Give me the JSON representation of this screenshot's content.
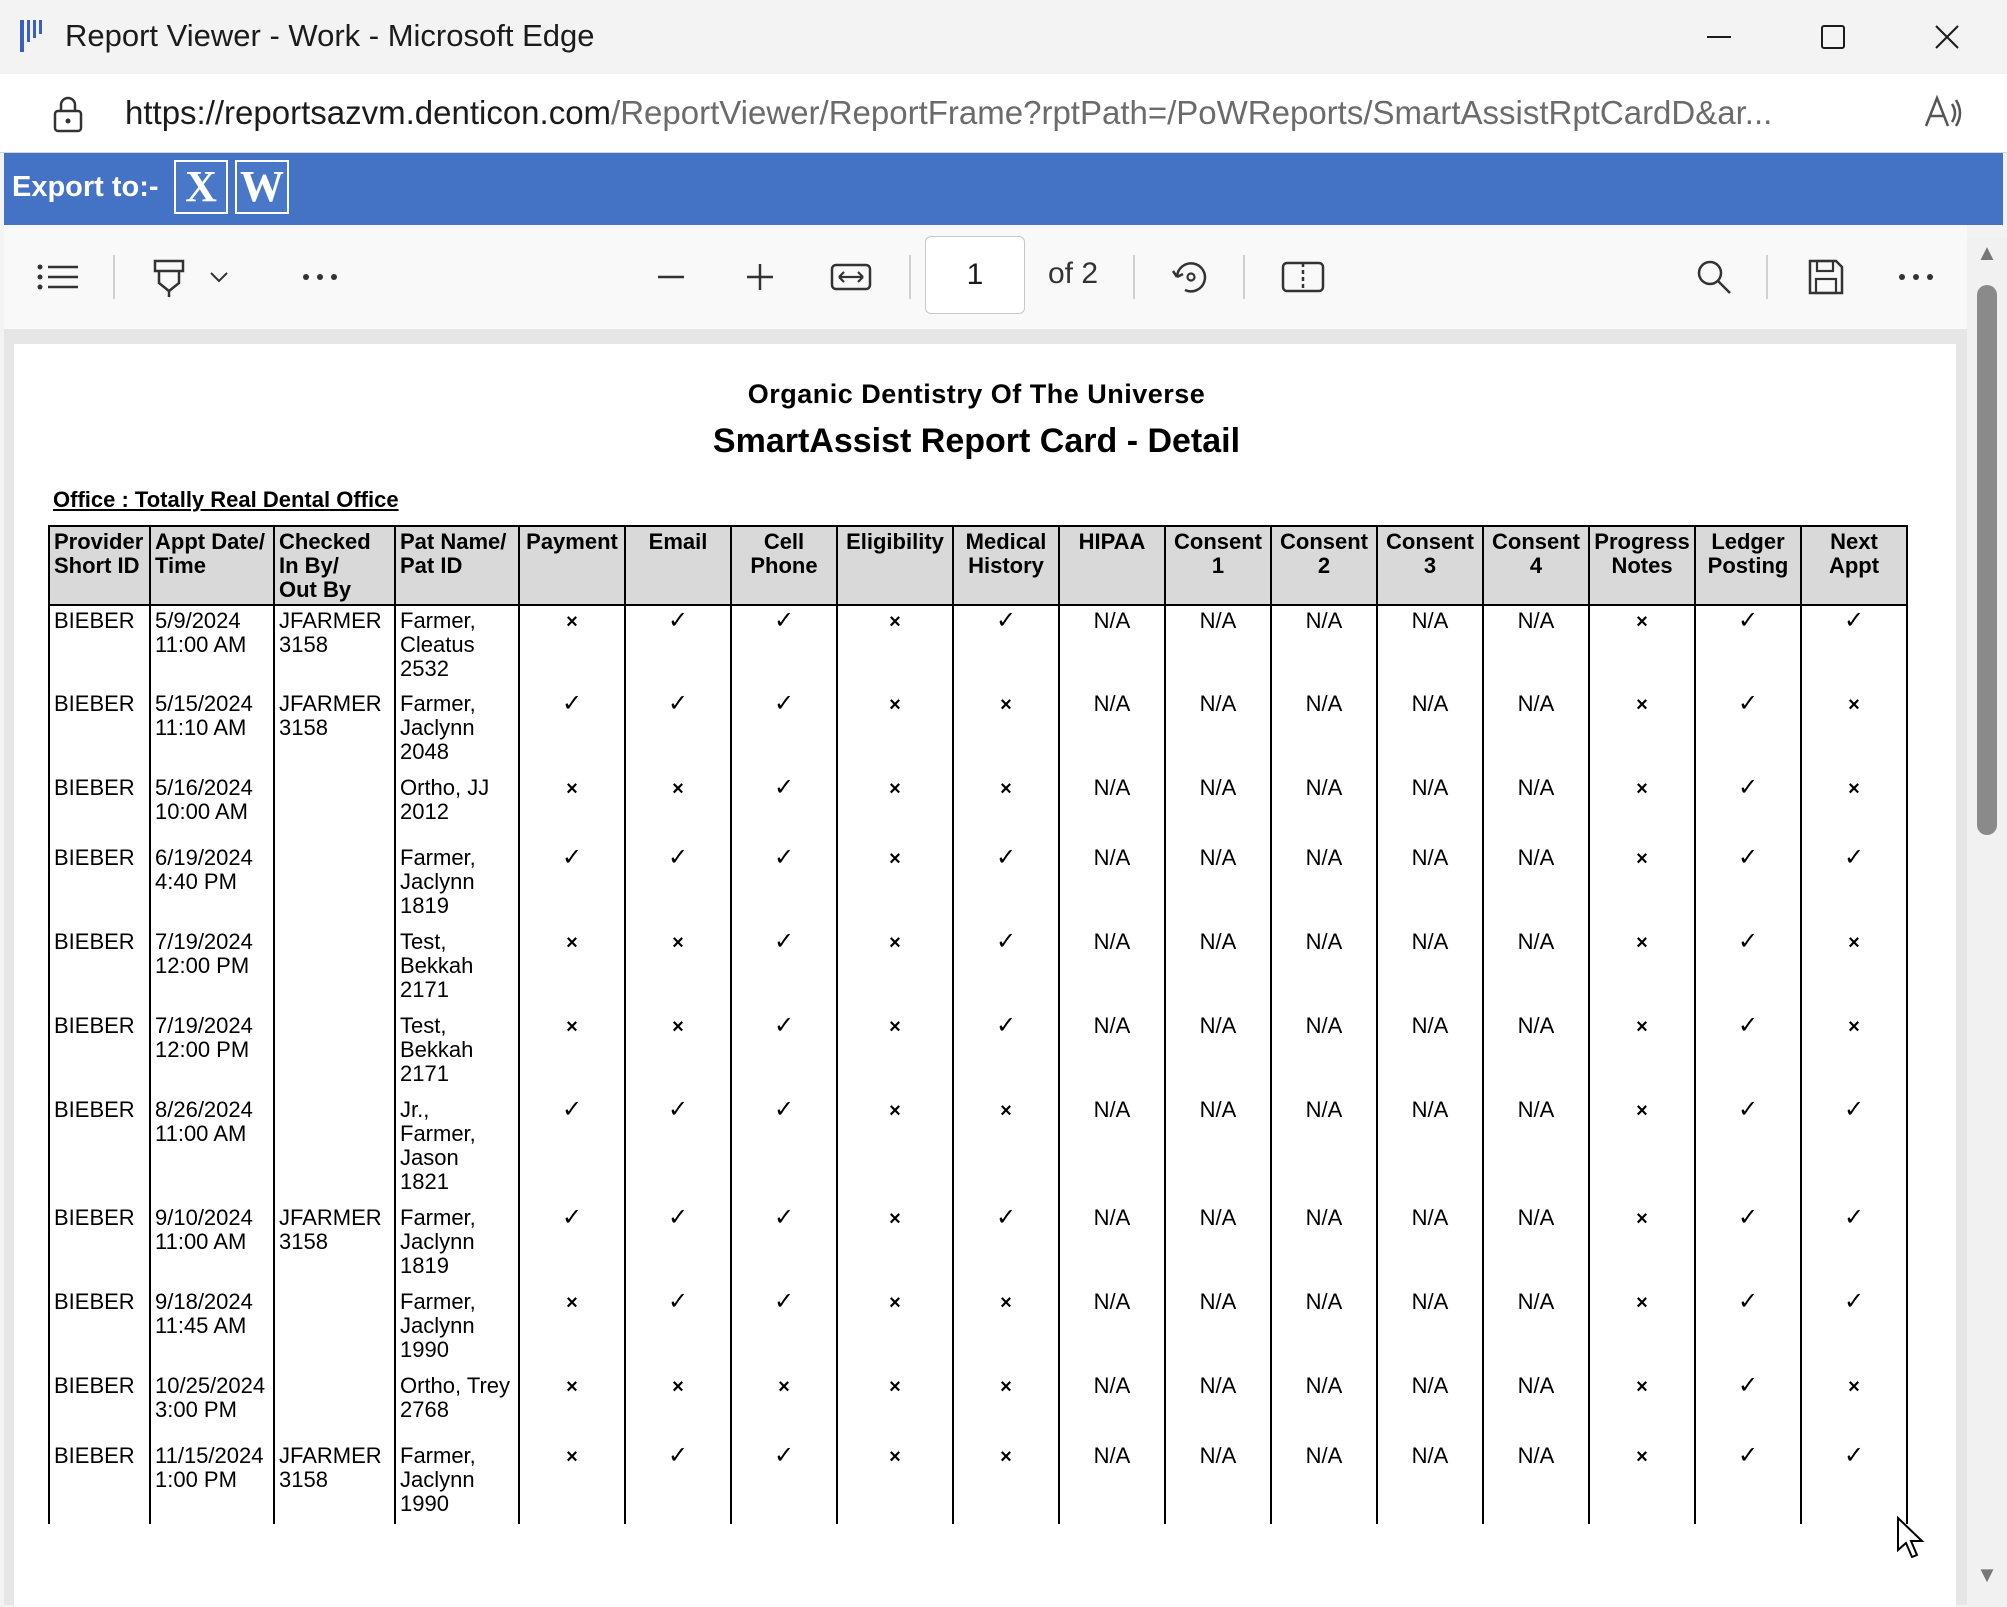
{
  "window": {
    "title": "Report Viewer - Work - Microsoft Edge",
    "minimize_label": "—",
    "maximize_label": "☐",
    "close_label": "✕"
  },
  "address": {
    "url_domain": "https://reportsazvm.denticon.com",
    "url_path": "/ReportViewer/ReportFrame?rptPath=/PoWReports/SmartAssistRptCardD&ar..."
  },
  "export": {
    "label": "Export to:-",
    "excel_label": "X",
    "word_label": "W"
  },
  "toolbar": {
    "page_current": "1",
    "page_total": "of 2",
    "icons": [
      "contents-icon",
      "draw-icon",
      "chevron-down-icon",
      "more-icon",
      "zoom-out-icon",
      "zoom-in-icon",
      "fit-width-icon",
      "rotate-icon",
      "page-view-icon",
      "search-icon",
      "save-icon",
      "more-options-icon"
    ]
  },
  "report": {
    "org_title": "Organic Dentistry Of The Universe",
    "title": "SmartAssist Report Card - Detail",
    "office_label": "Office : Totally Real Dental Office",
    "columns": [
      [
        "Provider",
        "Short ID"
      ],
      [
        "Appt Date/",
        "Time"
      ],
      [
        "Checked",
        "In By/",
        "Out By"
      ],
      [
        "Pat Name/",
        "Pat ID"
      ],
      [
        "Payment"
      ],
      [
        "Email"
      ],
      [
        "Cell",
        "Phone"
      ],
      [
        "Eligibility"
      ],
      [
        "Medical",
        "History"
      ],
      [
        "HIPAA"
      ],
      [
        "Consent",
        "1"
      ],
      [
        "Consent",
        "2"
      ],
      [
        "Consent",
        "3"
      ],
      [
        "Consent",
        "4"
      ],
      [
        "Progress",
        "Notes"
      ],
      [
        "Ledger",
        "Posting"
      ],
      [
        "Next",
        "Appt"
      ]
    ],
    "rows": [
      {
        "provider": "BIEBER",
        "appt": [
          "5/9/2024",
          "11:00 AM"
        ],
        "checked": [
          "JFARMER",
          "3158"
        ],
        "patient": [
          "Farmer,",
          "Cleatus",
          "2532"
        ],
        "marks": [
          "x",
          "y",
          "y",
          "x",
          "y",
          "N/A",
          "N/A",
          "N/A",
          "N/A",
          "N/A",
          "x",
          "y",
          "y"
        ]
      },
      {
        "provider": "BIEBER",
        "appt": [
          "5/15/2024",
          "11:10 AM"
        ],
        "checked": [
          "JFARMER",
          "3158"
        ],
        "patient": [
          "Farmer,",
          "Jaclynn",
          "2048"
        ],
        "marks": [
          "y",
          "y",
          "y",
          "x",
          "x",
          "N/A",
          "N/A",
          "N/A",
          "N/A",
          "N/A",
          "x",
          "y",
          "x"
        ]
      },
      {
        "provider": "BIEBER",
        "appt": [
          "5/16/2024",
          "10:00 AM"
        ],
        "checked": [],
        "patient": [
          "Ortho, JJ",
          "2012"
        ],
        "marks": [
          "x",
          "x",
          "y",
          "x",
          "x",
          "N/A",
          "N/A",
          "N/A",
          "N/A",
          "N/A",
          "x",
          "y",
          "x"
        ]
      },
      {
        "provider": "BIEBER",
        "appt": [
          "6/19/2024",
          "4:40 PM"
        ],
        "checked": [],
        "patient": [
          "Farmer,",
          "Jaclynn",
          "1819"
        ],
        "marks": [
          "y",
          "y",
          "y",
          "x",
          "y",
          "N/A",
          "N/A",
          "N/A",
          "N/A",
          "N/A",
          "x",
          "y",
          "y"
        ]
      },
      {
        "provider": "BIEBER",
        "appt": [
          "7/19/2024",
          "12:00 PM"
        ],
        "checked": [],
        "patient": [
          "Test,",
          "Bekkah",
          "2171"
        ],
        "marks": [
          "x",
          "x",
          "y",
          "x",
          "y",
          "N/A",
          "N/A",
          "N/A",
          "N/A",
          "N/A",
          "x",
          "y",
          "x"
        ]
      },
      {
        "provider": "BIEBER",
        "appt": [
          "7/19/2024",
          "12:00 PM"
        ],
        "checked": [],
        "patient": [
          "Test,",
          "Bekkah",
          "2171"
        ],
        "marks": [
          "x",
          "x",
          "y",
          "x",
          "y",
          "N/A",
          "N/A",
          "N/A",
          "N/A",
          "N/A",
          "x",
          "y",
          "x"
        ]
      },
      {
        "provider": "BIEBER",
        "appt": [
          "8/26/2024",
          "11:00 AM"
        ],
        "checked": [],
        "patient": [
          "Jr.,",
          "Farmer,",
          "Jason",
          "1821"
        ],
        "marks": [
          "y",
          "y",
          "y",
          "x",
          "x",
          "N/A",
          "N/A",
          "N/A",
          "N/A",
          "N/A",
          "x",
          "y",
          "y"
        ]
      },
      {
        "provider": "BIEBER",
        "appt": [
          "9/10/2024",
          "11:00 AM"
        ],
        "checked": [
          "JFARMER",
          "3158"
        ],
        "patient": [
          "Farmer,",
          "Jaclynn",
          "1819"
        ],
        "marks": [
          "y",
          "y",
          "y",
          "x",
          "y",
          "N/A",
          "N/A",
          "N/A",
          "N/A",
          "N/A",
          "x",
          "y",
          "y"
        ]
      },
      {
        "provider": "BIEBER",
        "appt": [
          "9/18/2024",
          "11:45 AM"
        ],
        "checked": [],
        "patient": [
          "Farmer,",
          "Jaclynn",
          "1990"
        ],
        "marks": [
          "x",
          "y",
          "y",
          "x",
          "x",
          "N/A",
          "N/A",
          "N/A",
          "N/A",
          "N/A",
          "x",
          "y",
          "y"
        ]
      },
      {
        "provider": "BIEBER",
        "appt": [
          "10/25/2024",
          "3:00 PM"
        ],
        "checked": [],
        "patient": [
          "Ortho, Trey",
          "2768"
        ],
        "marks": [
          "x",
          "x",
          "x",
          "x",
          "x",
          "N/A",
          "N/A",
          "N/A",
          "N/A",
          "N/A",
          "x",
          "y",
          "x"
        ]
      },
      {
        "provider": "BIEBER",
        "appt": [
          "11/15/2024",
          "1:00 PM"
        ],
        "checked": [
          "JFARMER",
          "3158"
        ],
        "patient": [
          "Farmer,",
          "Jaclynn",
          "1990"
        ],
        "marks": [
          "x",
          "y",
          "y",
          "x",
          "x",
          "N/A",
          "N/A",
          "N/A",
          "N/A",
          "N/A",
          "x",
          "y",
          "y"
        ]
      }
    ],
    "mark_glyphs": {
      "y": "✓",
      "x": "×"
    }
  },
  "colors": {
    "export_bar": "#4472c4",
    "header_fill": "#d9d9d9"
  }
}
